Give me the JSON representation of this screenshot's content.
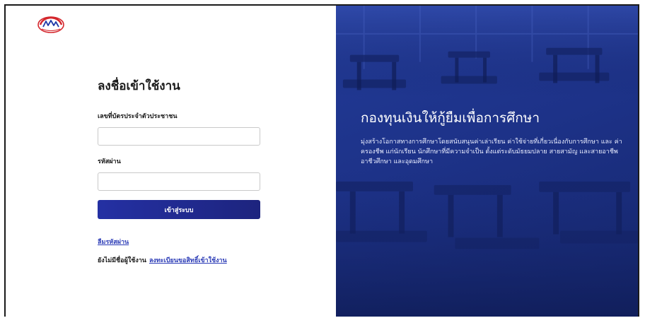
{
  "colors": {
    "accent": "#2430a3",
    "link": "#2d3db7",
    "panel": "#1d3288"
  },
  "logo": {
    "icon": "logo-icon"
  },
  "login": {
    "title": "ลงชื่อเข้าใช้งาน",
    "id_label": "เลขที่บัตรประจำตัวประชาชน",
    "id_value": "",
    "id_placeholder": "",
    "password_label": "รหัสผ่าน",
    "password_value": "",
    "password_placeholder": "",
    "submit_label": "เข้าสู่ระบบ",
    "forgot_label": "ลืมรหัสผ่าน",
    "no_account_text": "ยังไม่มีชื่อผู้ใช้งาน",
    "register_label": "ลงทะเบียนขอสิทธิ์เข้าใช้งาน"
  },
  "promo": {
    "headline": "กองทุนเงินให้กู้ยืมเพื่อการศึกษา",
    "description": "มุ่งสร้างโอกาสทางการศึกษาโดยสนับสนุนค่าเล่าเรียน ค่าใช้จ่ายที่เกี่ยวเนื่องกับการศึกษา และ ค่าครองชีพ แก่นักเรียน นักศึกษาที่มีความจำเป็น ตั้งแต่ระดับมัธยมปลาย สายสามัญ และสายอาชีพ อาชีวศึกษา และอุดมศึกษา"
  }
}
